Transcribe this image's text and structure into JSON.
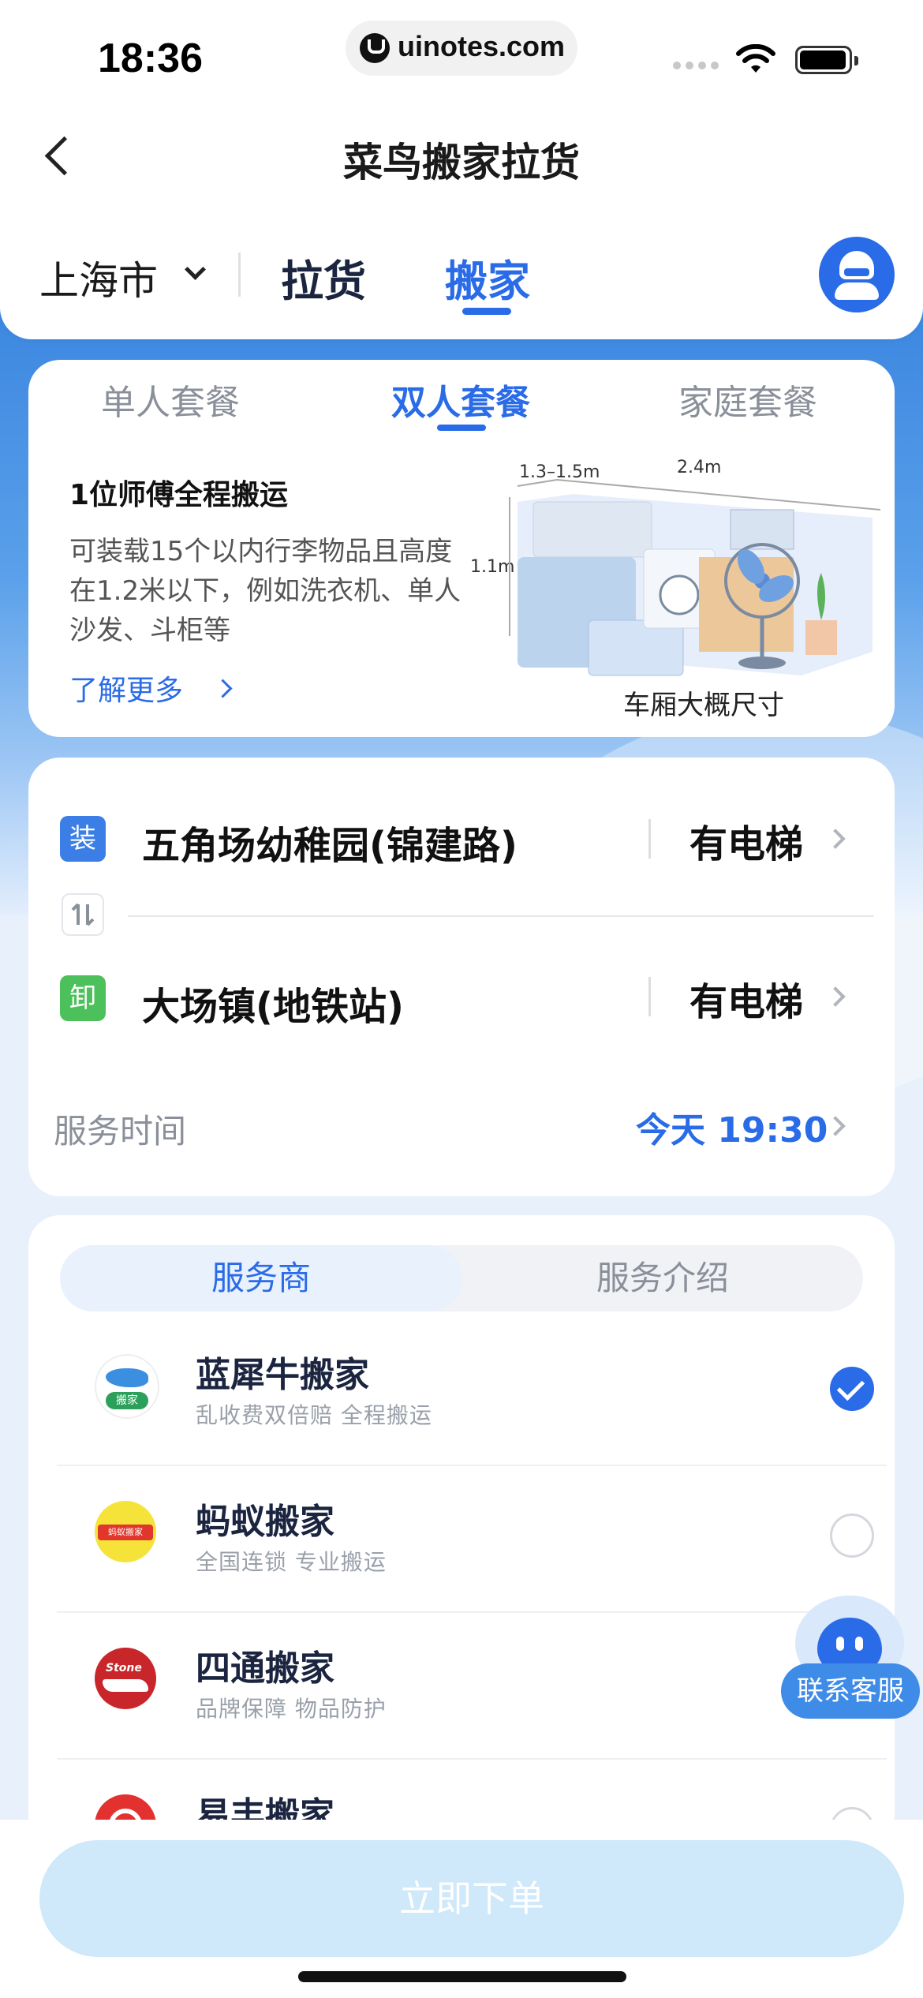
{
  "status_bar": {
    "time": "18:36",
    "url": "uinotes.com"
  },
  "header": {
    "title": "菜鸟搬家拉货"
  },
  "city_bar": {
    "city": "上海市",
    "tabs": [
      {
        "label": "拉货"
      },
      {
        "label": "搬家"
      }
    ],
    "active_tab": "搬家"
  },
  "package": {
    "tabs": [
      {
        "label": "单人套餐"
      },
      {
        "label": "双人套餐"
      },
      {
        "label": "家庭套餐"
      }
    ],
    "active_tab": "双人套餐",
    "title": "1位师傅全程搬运",
    "description": "可装载15个以内行李物品且高度在1.2米以下，例如洗衣机、单人沙发、斗柜等",
    "learn_more": "了解更多",
    "truck": {
      "dim_width": "1.3–1.5m",
      "dim_length": "2.4m",
      "dim_height": "1.1m",
      "caption": "车厢大概尺寸"
    }
  },
  "route": {
    "load_badge": "装",
    "load_address": "五角场幼稚园(锦建路)",
    "load_elevator": "有电梯",
    "unload_badge": "卸",
    "unload_address": "大场镇(地铁站)",
    "unload_elevator": "有电梯",
    "service_time_label": "服务时间",
    "service_time_value": "今天 19:30"
  },
  "providers": {
    "tabs": [
      {
        "label": "服务商"
      },
      {
        "label": "服务介绍"
      }
    ],
    "active_tab": "服务商",
    "items": [
      {
        "name": "蓝犀牛搬家",
        "tags": "乱收费双倍赔  全程搬运",
        "selected": true,
        "logo_text": "搬家"
      },
      {
        "name": "蚂蚁搬家",
        "tags": "全国连锁  专业搬运",
        "selected": false,
        "logo_text": "蚂蚁搬家"
      },
      {
        "name": "四通搬家",
        "tags": "品牌保障  物品防护",
        "selected": false,
        "logo_text": "Stone"
      },
      {
        "name": "易丰搬家",
        "tags": "",
        "selected": false,
        "logo_text": ""
      }
    ]
  },
  "customer_service": {
    "label": "联系客服"
  },
  "footer": {
    "order_button": "立即下单"
  },
  "colors": {
    "accent": "#2a6be8",
    "load_badge": "#3a7ee6",
    "unload_badge": "#4cc05a",
    "order_button_bg": "#cfe8fa"
  }
}
